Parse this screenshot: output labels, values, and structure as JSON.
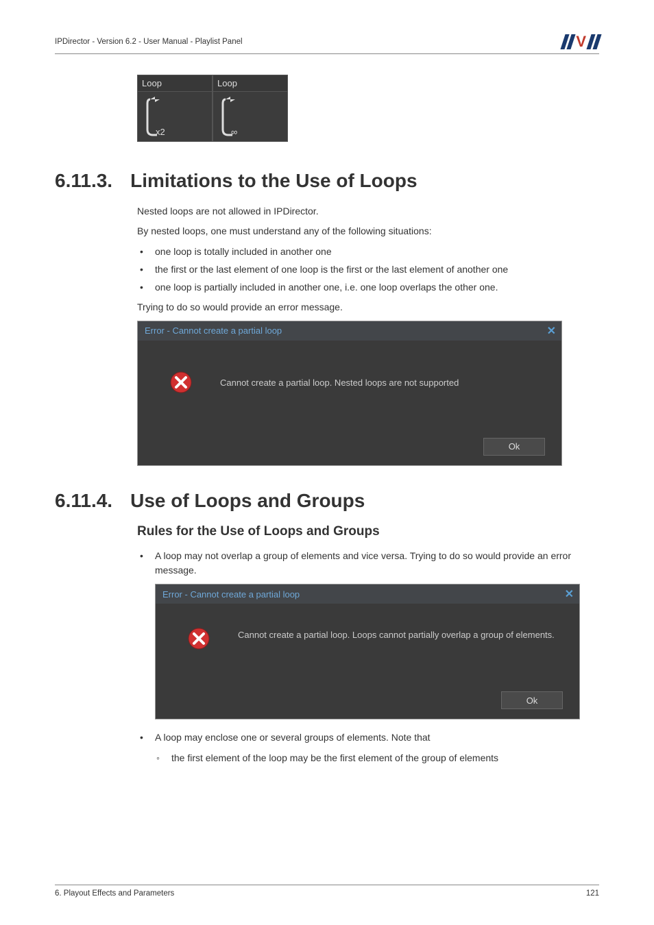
{
  "header": {
    "text": "IPDirector - Version 6.2 - User Manual - Playlist Panel"
  },
  "loopImages": {
    "label1": "Loop",
    "sub1": "x2",
    "label2": "Loop",
    "sub2": "∞"
  },
  "section1": {
    "num": "6.11.3.",
    "title": "Limitations to the Use of Loops",
    "p1": "Nested loops are not allowed in IPDirector.",
    "p2": "By nested loops, one must understand any of the following situations:",
    "b1": "one loop is totally included in another one",
    "b2": "the first or the last element of one loop is the first or the last element of another one",
    "b3": "one loop is partially included in another one, i.e. one loop overlaps the other one.",
    "p3": "Trying to do so would provide an error message."
  },
  "dialog1": {
    "title": "Error - Cannot create a partial loop",
    "msg": "Cannot create a partial loop. Nested loops are not supported",
    "ok": "Ok"
  },
  "section2": {
    "num": "6.11.4.",
    "title": "Use of Loops and Groups",
    "subheading": "Rules for the Use of Loops and Groups",
    "b1": "A loop may not overlap a group of elements and vice versa. Trying to do so would provide an error message.",
    "b2": "A loop may enclose one or several groups of elements. Note that",
    "sb1": "the first element of the loop may be the first element of the group of elements"
  },
  "dialog2": {
    "title": "Error - Cannot create a partial loop",
    "msg": "Cannot create a partial loop. Loops cannot partially overlap a group of elements.",
    "ok": "Ok"
  },
  "footer": {
    "left": "6. Playout Effects and Parameters",
    "right": "121"
  }
}
